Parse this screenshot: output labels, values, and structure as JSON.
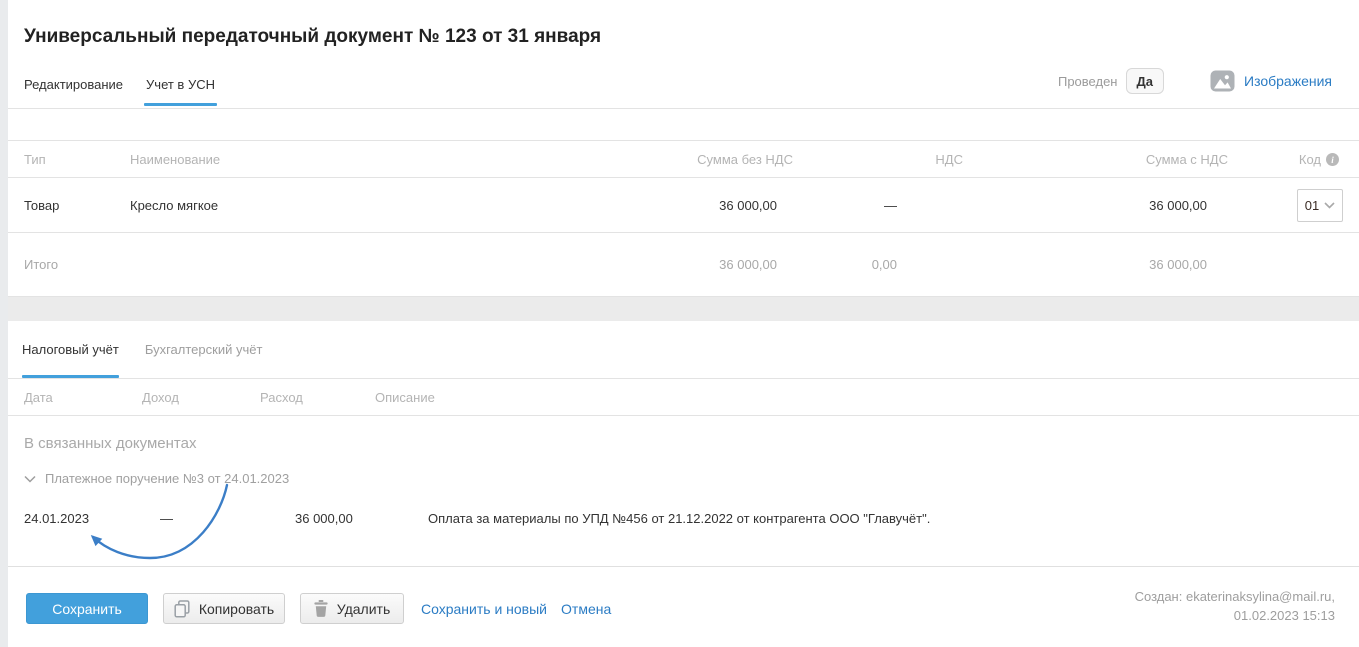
{
  "page": {
    "title": "Универсальный передаточный документ № 123 от 31 января"
  },
  "header": {
    "tabs": {
      "editing": "Редактирование",
      "usn": "Учет в УСН"
    },
    "posted_label": "Проведен",
    "posted_value": "Да",
    "images_label": "Изображения"
  },
  "items_table": {
    "columns": {
      "type": "Тип",
      "name": "Наименование",
      "sum_no_vat": "Сумма без НДС",
      "vat": "НДС",
      "sum_with_vat": "Сумма с НДС",
      "code": "Код"
    },
    "rows": [
      {
        "type": "Товар",
        "name": "Кресло мягкое",
        "sum_no_vat": "36 000,00",
        "vat": "—",
        "sum_with_vat": "36 000,00",
        "code": "01"
      }
    ],
    "total": {
      "label": "Итого",
      "sum_no_vat": "36 000,00",
      "vat": "0,00",
      "sum_with_vat": "36 000,00"
    }
  },
  "accounting": {
    "tabs": {
      "tax": "Налоговый учёт",
      "book": "Бухгалтерский учёт"
    },
    "columns": {
      "date": "Дата",
      "income": "Доход",
      "expense": "Расход",
      "description": "Описание"
    },
    "linked_title": "В связанных документах",
    "linked_group": "Платежное поручение №3 от 24.01.2023",
    "rows": [
      {
        "date": "24.01.2023",
        "income": "—",
        "expense": "36 000,00",
        "description": "Оплата за материалы по УПД №456 от 21.12.2022 от контрагента ООО \"Главучёт\"."
      }
    ]
  },
  "footer": {
    "save": "Сохранить",
    "copy": "Копировать",
    "delete": "Удалить",
    "save_new": "Сохранить и новый",
    "cancel": "Отмена",
    "created_line1": "Создан: ekaterinaksylina@mail.ru,",
    "created_line2": "01.02.2023 15:13"
  },
  "colors": {
    "accent_blue": "#42a0dc",
    "link_blue": "#2b7cc4",
    "arrow_blue": "#3b7ec7",
    "muted_text": "#a8a8a8",
    "band_gray": "#ebebeb"
  }
}
